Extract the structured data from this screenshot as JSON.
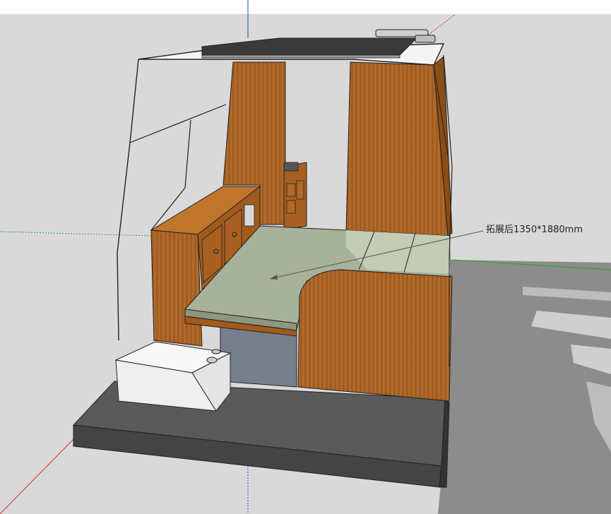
{
  "viewport": {
    "annotation_text": "拓展后1350*1880mm"
  },
  "colors": {
    "sky": "#d7d7d7",
    "ground_top": "#dcdcdc",
    "shadow": "#8a8a8a",
    "floor": "#5b5b5b",
    "wood": "#b36a24",
    "wood_dark": "#8a4d14",
    "bed_top": "#a8b29a",
    "bed_light": "#c3ccb4",
    "tank": "#f4f4f4",
    "axis_red": "#d92a2a",
    "axis_green": "#22aa22",
    "axis_blue": "#3344cc"
  }
}
